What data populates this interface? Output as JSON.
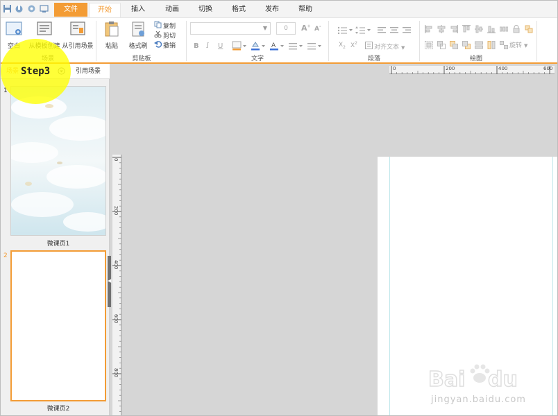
{
  "menubar": {
    "tabs": [
      {
        "label": "文件"
      },
      {
        "label": "开始"
      },
      {
        "label": "插入"
      },
      {
        "label": "动画"
      },
      {
        "label": "切换"
      },
      {
        "label": "格式"
      },
      {
        "label": "发布"
      },
      {
        "label": "帮助"
      }
    ],
    "active_tab": "开始"
  },
  "ribbon": {
    "scene_group": {
      "label": "场景",
      "buttons": [
        "空白",
        "从模板创建",
        "从引用场景"
      ]
    },
    "clipboard_group": {
      "label": "剪贴板",
      "buttons": [
        "粘贴",
        "格式刷"
      ],
      "small_buttons": [
        "复制",
        "剪切",
        "撤销"
      ]
    },
    "text_group": {
      "label": "文字",
      "font_size_value": "0"
    },
    "paragraph_group": {
      "label": "段落",
      "align_text_label": "对齐文本"
    },
    "drawing_group": {
      "label": "绘图",
      "rotate_label": "旋转"
    }
  },
  "left_panel": {
    "tabs": [
      "场景",
      "引用场景"
    ],
    "slides": [
      {
        "number": "1",
        "title": "微课页1"
      },
      {
        "number": "2",
        "title": "微课页2"
      }
    ]
  },
  "rulers": {
    "horizontal_ticks": [
      "0",
      "200",
      "400",
      "600"
    ],
    "vertical_ticks": [
      "0",
      "200",
      "400",
      "600",
      "800"
    ]
  },
  "overlay": {
    "step_label": "Step3"
  },
  "watermark": {
    "brand": "Baidu经验",
    "url": "jingyan.baidu.com"
  },
  "colors": {
    "accent": "#f39c35",
    "ribbon_bg": "#ffffff",
    "workspace_bg": "#d6d6d6",
    "highlight": "#ffff00"
  }
}
